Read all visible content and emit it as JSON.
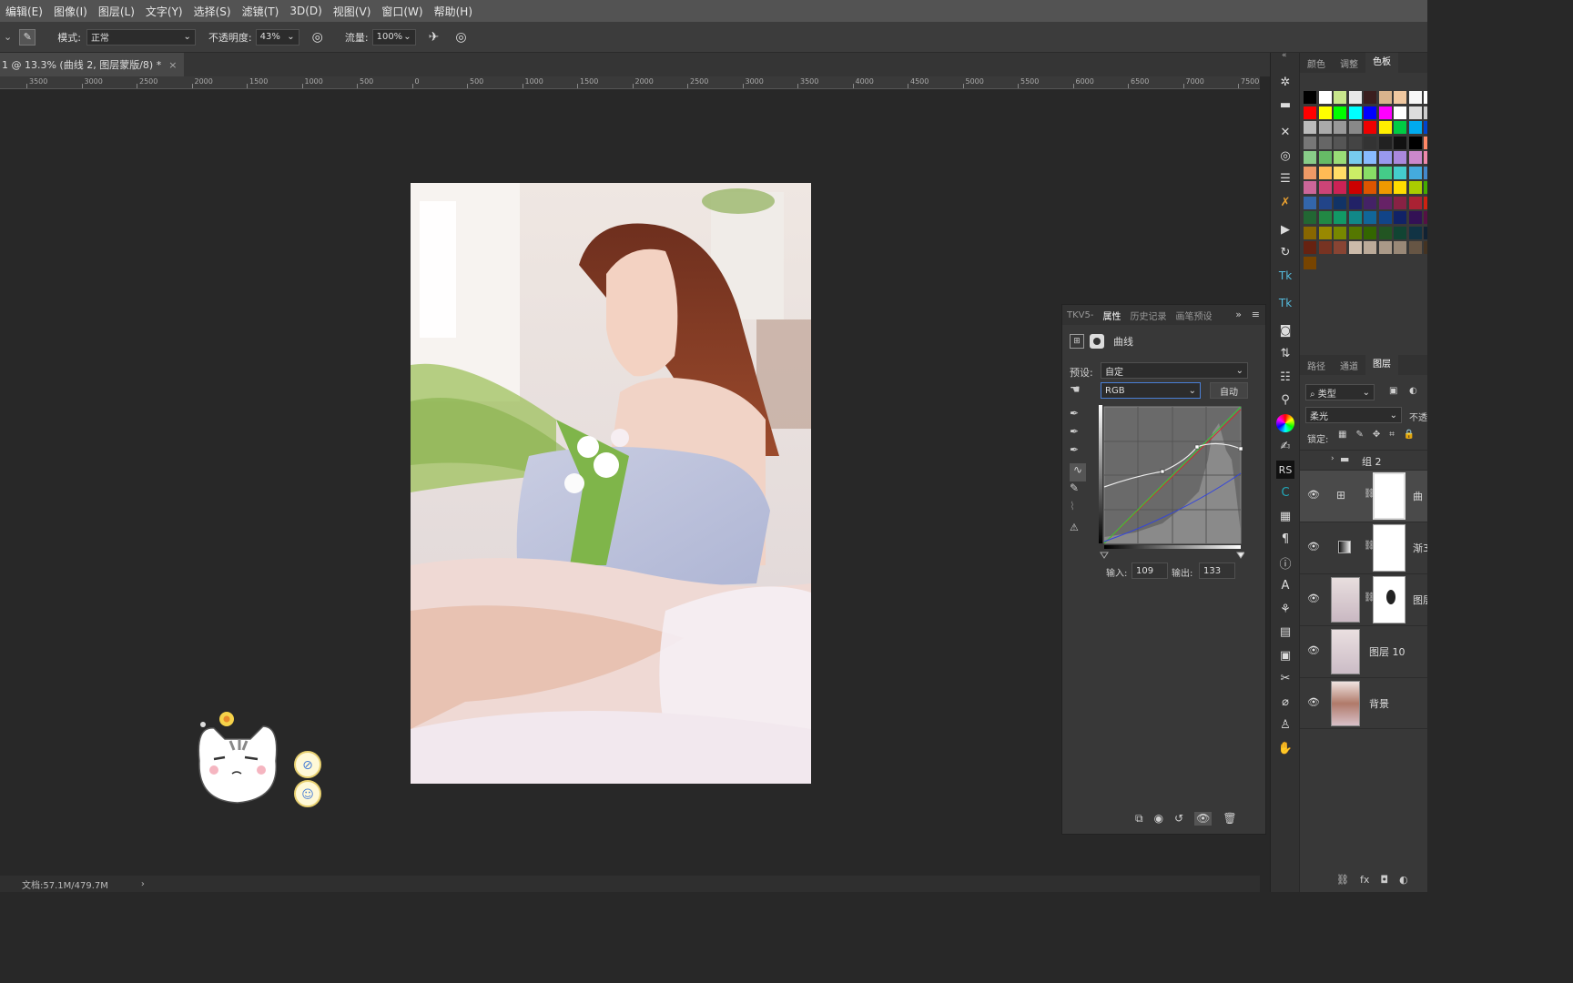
{
  "menu": [
    "编辑(E)",
    "图像(I)",
    "图层(L)",
    "文字(Y)",
    "选择(S)",
    "滤镜(T)",
    "3D(D)",
    "视图(V)",
    "窗口(W)",
    "帮助(H)"
  ],
  "options": {
    "mode_label": "模式:",
    "mode_value": "正常",
    "opacity_label": "不透明度:",
    "opacity_value": "43%",
    "flow_label": "流量:",
    "flow_value": "100%"
  },
  "document_tab": {
    "title": "1 @ 13.3% (曲线 2, 图层蒙版/8) *",
    "close": "×"
  },
  "ruler_ticks": [
    "3500",
    "3000",
    "2500",
    "2000",
    "1500",
    "1000",
    "500",
    "0",
    "500",
    "1000",
    "1500",
    "2000",
    "2500",
    "3000",
    "3500",
    "4000",
    "4500",
    "5000",
    "5500",
    "6000",
    "6500",
    "7000",
    "7500"
  ],
  "status": {
    "doc_size": "文档:57.1M/479.7M",
    "arrow": "›"
  },
  "swatch_panel": {
    "tabs": [
      "颜色",
      "调整",
      "色板"
    ],
    "active": "色板"
  },
  "swatch_colors": [
    [
      "#000000",
      "#ffffff",
      "#c8e68c",
      "#e8e8e8",
      "#3a1e1e",
      "#d9b38c",
      "#f0c8a0",
      "#f7f7f7",
      "#ffffff"
    ],
    [
      "#ff0000",
      "#ffff00",
      "#00ff00",
      "#00ffff",
      "#0000ff",
      "#ff00ff",
      "#ffffff",
      "#dddddd",
      "#cccccc"
    ],
    [
      "#bbbbbb",
      "#aaaaaa",
      "#999999",
      "#888888",
      "#ee0000",
      "#ffee00",
      "#00cc44",
      "#00aaee",
      "#0044cc"
    ],
    [
      "#777777",
      "#666666",
      "#555555",
      "#444444",
      "#333333",
      "#222222",
      "#111111",
      "#000000",
      "#ff8866"
    ],
    [
      "#88cc88",
      "#66bb66",
      "#99dd77",
      "#77ccee",
      "#88bbff",
      "#9999ee",
      "#aa88dd",
      "#cc88cc",
      "#ee88aa"
    ],
    [
      "#ee9966",
      "#ffbb55",
      "#ffdd66",
      "#ccee66",
      "#88dd66",
      "#44cc88",
      "#44cccc",
      "#44aadd",
      "#4488cc"
    ],
    [
      "#cc6699",
      "#cc4477",
      "#cc2255",
      "#cc0000",
      "#dd5500",
      "#ee9900",
      "#ffdd00",
      "#aacc00",
      "#44aa00"
    ],
    [
      "#3366aa",
      "#224488",
      "#113366",
      "#222266",
      "#442266",
      "#662266",
      "#882244",
      "#aa2233",
      "#cc2211"
    ],
    [
      "#226633",
      "#228844",
      "#119966",
      "#118888",
      "#116699",
      "#114488",
      "#112266",
      "#331155",
      "#551144"
    ],
    [
      "#886600",
      "#998800",
      "#778800",
      "#557700",
      "#336600",
      "#225522",
      "#114433",
      "#113344",
      "#112233"
    ],
    [
      "#662211",
      "#773322",
      "#884433",
      "#ccbbaa",
      "#bbaa99",
      "#aa9988",
      "#998877",
      "#665544",
      "#443322"
    ],
    [
      "#774400"
    ]
  ],
  "properties": {
    "tabs": [
      "TKV5-",
      " 属性",
      "历史记录",
      "画笔预设"
    ],
    "active_tab": "属性",
    "title": "曲线",
    "preset_label": "预设:",
    "preset_value": "自定",
    "channel_value": "RGB",
    "auto_label": "自动",
    "input_label": "输入:",
    "input_value": "109",
    "output_label": "输出:",
    "output_value": "133"
  },
  "layers_panel": {
    "tabs": [
      "路径",
      "通道",
      "图层"
    ],
    "active": "图层",
    "filter_label": "类型",
    "blend_mode": "柔光",
    "opacity_prefix": "不透",
    "lock_label": "锁定:",
    "layers": [
      {
        "name": "组 2",
        "type": "group"
      },
      {
        "name": "曲",
        "type": "curves"
      },
      {
        "name": "渐3",
        "type": "gradient"
      },
      {
        "name": "图层",
        "type": "image-mask"
      },
      {
        "name": "图层 10",
        "type": "image"
      },
      {
        "name": "背景",
        "type": "background"
      }
    ]
  },
  "toolbar_icons": [
    "move-icon",
    "ruler-icon",
    "x-icon",
    "filter-icon",
    "stack-icon",
    "cross-icon",
    "play-icon",
    "rotate-icon",
    "tk-icon",
    "tk-icon",
    "camera-icon",
    "adjust-icon",
    "sliders-icon",
    "brush-icon",
    "color-wheel-icon",
    "pen-icon",
    "rs-icon",
    "c-icon",
    "grid-icon",
    "paragraph-icon",
    "info-icon",
    "type-icon",
    "stamp-icon",
    "layer-comp-icon",
    "notes-icon",
    "scissors-icon",
    "chain-icon",
    "bulb-icon",
    "hand-icon"
  ]
}
